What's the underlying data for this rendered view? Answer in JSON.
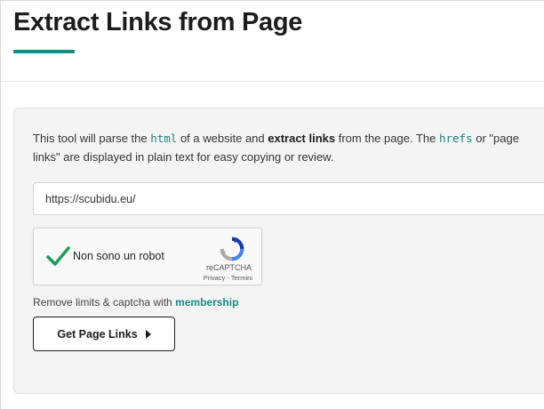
{
  "header": {
    "title": "Extract Links from Page"
  },
  "description": {
    "part1": "This tool will parse the ",
    "code1": "html",
    "part2": " of a website and ",
    "bold1": "extract links",
    "part3": " from the page. The ",
    "code2": "hrefs",
    "part4": " or \"page links\" are displayed in plain text for easy copying or review."
  },
  "url_input": {
    "value": "https://scubidu.eu/"
  },
  "captcha": {
    "label": "Non sono un robot",
    "brand": "reCAPTCHA",
    "privacy": "Privacy",
    "separator": " - ",
    "terms": "Termini",
    "checked": true
  },
  "limits": {
    "text": "Remove limits & captcha with ",
    "link": "membership"
  },
  "submit": {
    "label": "Get Page Links",
    "icon": "play-icon"
  },
  "colors": {
    "accent": "#178a86",
    "check": "#1e9c57"
  }
}
